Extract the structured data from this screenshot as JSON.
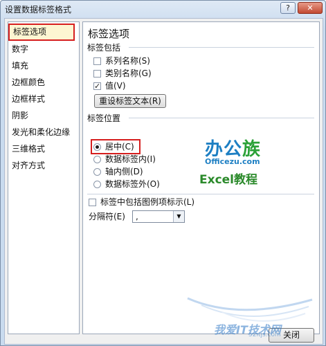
{
  "window": {
    "title": "设置数据标签格式",
    "help_label": "?",
    "close_label": "✕"
  },
  "nav": {
    "items": [
      {
        "label": "标签选项",
        "selected": true
      },
      {
        "label": "数字"
      },
      {
        "label": "填充"
      },
      {
        "label": "边框颜色"
      },
      {
        "label": "边框样式"
      },
      {
        "label": "阴影"
      },
      {
        "label": "发光和柔化边缘"
      },
      {
        "label": "三维格式"
      },
      {
        "label": "对齐方式"
      }
    ]
  },
  "panel": {
    "heading": "标签选项",
    "contains": {
      "label": "标签包括",
      "series_name": {
        "label": "系列名称(S)",
        "checked": false
      },
      "category_name": {
        "label": "类别名称(G)",
        "checked": false
      },
      "value": {
        "label": "值(V)",
        "checked": true
      },
      "reset_button": "重设标签文本(R)"
    },
    "position": {
      "label": "标签位置",
      "options": [
        {
          "label": "居中(C)",
          "selected": true
        },
        {
          "label": "数据标签内(I)",
          "selected": false
        },
        {
          "label": "轴内侧(D)",
          "selected": false
        },
        {
          "label": "数据标签外(O)",
          "selected": false
        }
      ]
    },
    "legend_key": {
      "label": "标签中包括图例项标示(L)",
      "checked": false
    },
    "separator": {
      "label": "分隔符(E)",
      "value": ","
    },
    "close_button": "关闭"
  },
  "overlay_logo": {
    "line1_a": "办公",
    "line1_b": "族",
    "line2": "Officezu.com",
    "line3": "Excel教程"
  },
  "watermark": {
    "text": "我爱IT技术网",
    "url": "52itjs.com"
  },
  "colors": {
    "highlight": "#d61e1e",
    "title_bg": "#c9dbef",
    "logo_blue": "#1d7fc3",
    "logo_green": "#2b8a2b"
  }
}
